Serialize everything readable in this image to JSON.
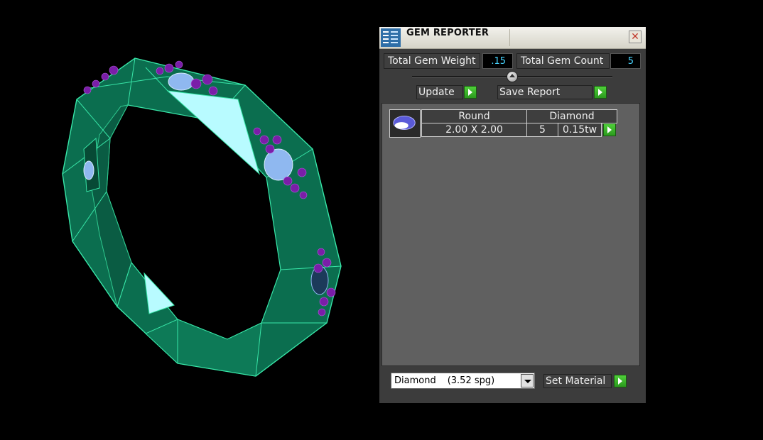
{
  "window": {
    "title": "GEM REPORTER",
    "close_glyph": "✕"
  },
  "totals": {
    "weight_label": "Total Gem Weight",
    "weight_value": ".15",
    "count_label": "Total Gem Count",
    "count_value": "5"
  },
  "slider": {
    "level": 0.5
  },
  "actions": {
    "update_label": "Update",
    "save_report_label": "Save Report"
  },
  "gem_list": [
    {
      "shape": "Round",
      "material": "Diamond",
      "size": "2.00 X 2.00",
      "count": "5",
      "weight": "0.15tw",
      "thumb_icon": "round-gem-icon"
    }
  ],
  "material_select": {
    "name": "Diamond",
    "density": "(3.52 spg)"
  },
  "set_material_label": "Set Material",
  "colors": {
    "ring": "#0b6e4f",
    "ring_edge": "#38e6a8",
    "facet": "#b8fbff",
    "prong": "#7a1ea8",
    "accent_blue": "#48d4ff",
    "go_green": "#3fbf2c"
  }
}
